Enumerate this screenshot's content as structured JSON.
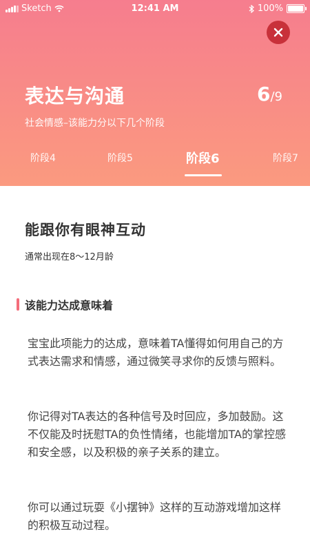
{
  "status_bar": {
    "carrier": "Sketch",
    "time": "12:41 AM",
    "battery": "100%"
  },
  "header": {
    "title": "表达与沟通",
    "progress_current": "6",
    "progress_total": "/9",
    "subtitle": "社会情感–该能力分以下几个阶段",
    "tabs": [
      {
        "label": "阶段4"
      },
      {
        "label": "阶段5"
      },
      {
        "label": "阶段6"
      },
      {
        "label": "阶段7"
      }
    ],
    "active_tab": "阶段6"
  },
  "content": {
    "skill_title": "能跟你有眼神互动",
    "skill_age": "通常出现在8～12月龄",
    "section_heading": "该能力达成意味着",
    "paragraphs": [
      "宝宝此项能力的达成，意味着TA懂得如何用自己的方式表达需求和情感，通过微笑寻求你的反馈与照料。",
      "你记得对TA表达的各种信号及时回应，多加鼓励。这不仅能及时抚慰TA的负性情绪，也能增加TA的掌控感和安全感，以及积极的亲子关系的建立。",
      "你可以通过玩耍《小摆钟》这样的互动游戏增加这样的积极互动过程。"
    ]
  },
  "colors": {
    "header_top": "#f67d8e",
    "header_bottom": "#fb9a7f",
    "close_button": "#c8313a",
    "accent_bar": "#f46d7b"
  },
  "icons": [
    "signal-icon",
    "wifi-icon",
    "bluetooth-icon",
    "battery-icon",
    "close-icon"
  ]
}
